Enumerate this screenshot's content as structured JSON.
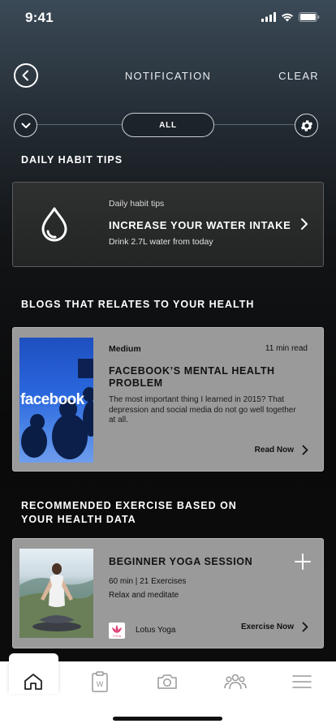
{
  "status": {
    "time": "9:41"
  },
  "header": {
    "title": "NOTIFICATION",
    "clear_label": "CLEAR"
  },
  "filter": {
    "selected": "ALL"
  },
  "daily_tips": {
    "section_title": "DAILY HABIT TIPS",
    "card": {
      "label": "Daily habit tips",
      "title": "INCREASE YOUR WATER INTAKE",
      "description": "Drink 2.7L water from today",
      "icon": "water-drop-icon"
    }
  },
  "blogs": {
    "section_title": "BLOGS THAT RELATES TO YOUR HEALTH",
    "card": {
      "source": "Medium",
      "read_time": "11 min read",
      "image_text": "facebook",
      "title": "FACEBOOK’S MENTAL HEALTH PROBLEM",
      "description": "The most important thing I learned in 2015? That depression and social media do not go well together at all.",
      "cta": "Read Now"
    }
  },
  "exercise": {
    "section_title_line1": "RECOMMENDED EXERCISE BASED ON",
    "section_title_line2": "YOUR HEALTH DATA",
    "card": {
      "title": "BEGINNER YOGA SESSION",
      "meta": "60 min | 21 Exercises",
      "description": "Relax and meditate",
      "provider_logo_text": "YOGA",
      "provider": "Lotus Yoga",
      "cta": "Exercise Now"
    }
  },
  "tab_bar": {
    "items": [
      "home-icon",
      "clipboard-icon",
      "camera-icon",
      "community-icon",
      "menu-icon"
    ],
    "clipboard_letter": "W",
    "active": "home-icon"
  },
  "colors": {
    "accent_logo": "#e0457b",
    "card_gray": "#9a9a9a"
  }
}
